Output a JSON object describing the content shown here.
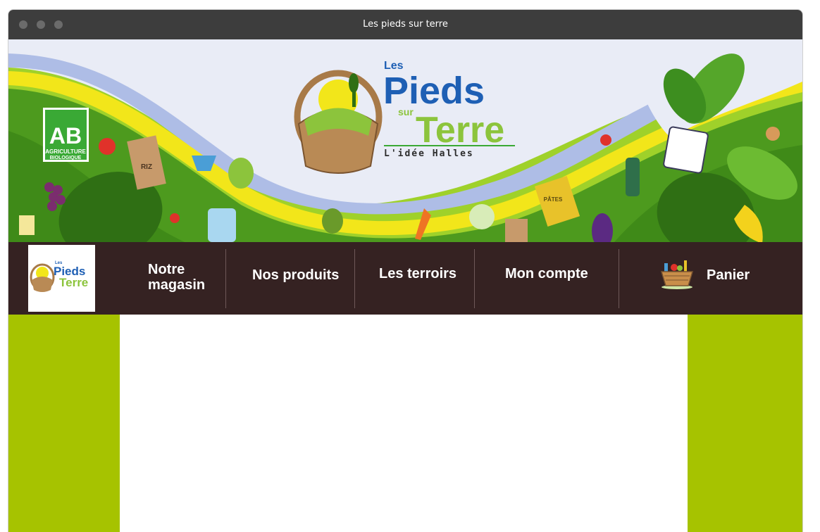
{
  "window": {
    "title": "Les pieds sur terre"
  },
  "banner": {
    "logo_les": "Les",
    "logo_pieds": "Pieds",
    "logo_sur": "sur",
    "logo_terre": "Terre",
    "logo_tagline": "L'idée Halles",
    "ab_letters": "AB",
    "ab_line1": "AGRICULTURE",
    "ab_line2": "BIOLOGIQUE",
    "label_riz": "RIZ",
    "label_pates": "PÂTES"
  },
  "nav": {
    "items": [
      {
        "label_line1": "Notre",
        "label_line2": "magasin"
      },
      {
        "label": "Nos produits"
      },
      {
        "label": "Les terroirs"
      },
      {
        "label": "Mon compte"
      },
      {
        "label": "Panier"
      }
    ],
    "logo_text": {
      "les": "Les",
      "pieds": "Pieds",
      "terre": "Terre"
    }
  },
  "colors": {
    "nav_background": "#352222",
    "side_green": "#a6c300",
    "logo_blue": "#1e5fb4",
    "logo_green": "#8cc43c",
    "titlebar": "#3d3d3d"
  }
}
